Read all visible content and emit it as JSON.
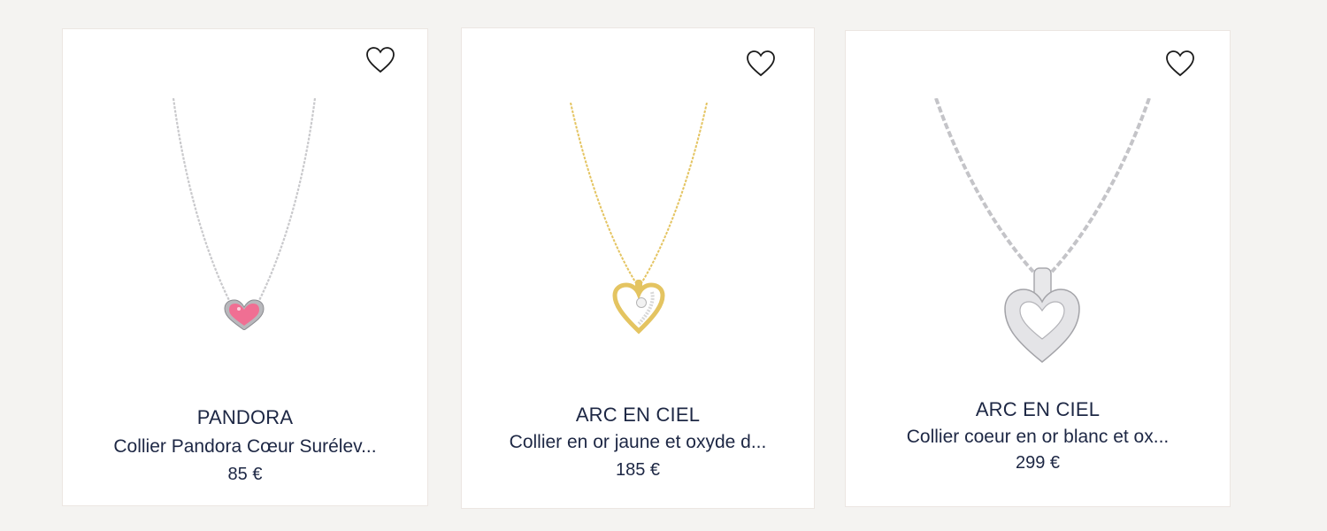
{
  "colors": {
    "page_bg": "#f4f3f1",
    "card_bg": "#ffffff",
    "text": "#1d2744",
    "silver": "#c9c9cc",
    "gold": "#e4c461",
    "pink_stone": "#f06f93"
  },
  "products": [
    {
      "brand": "PANDORA",
      "name": "Collier Pandora Cœur Surélev...",
      "price": "85 €",
      "favorite_icon": "heart-outline-icon",
      "image_icon": "pink-heart-necklace-image"
    },
    {
      "brand": "ARC EN CIEL",
      "name": "Collier en or jaune et oxyde d...",
      "price": "185 €",
      "favorite_icon": "heart-outline-icon",
      "image_icon": "gold-heart-necklace-image"
    },
    {
      "brand": "ARC EN CIEL",
      "name": "Collier coeur en or blanc et ox...",
      "price": "299 €",
      "favorite_icon": "heart-outline-icon",
      "image_icon": "white-gold-heart-necklace-image"
    }
  ]
}
